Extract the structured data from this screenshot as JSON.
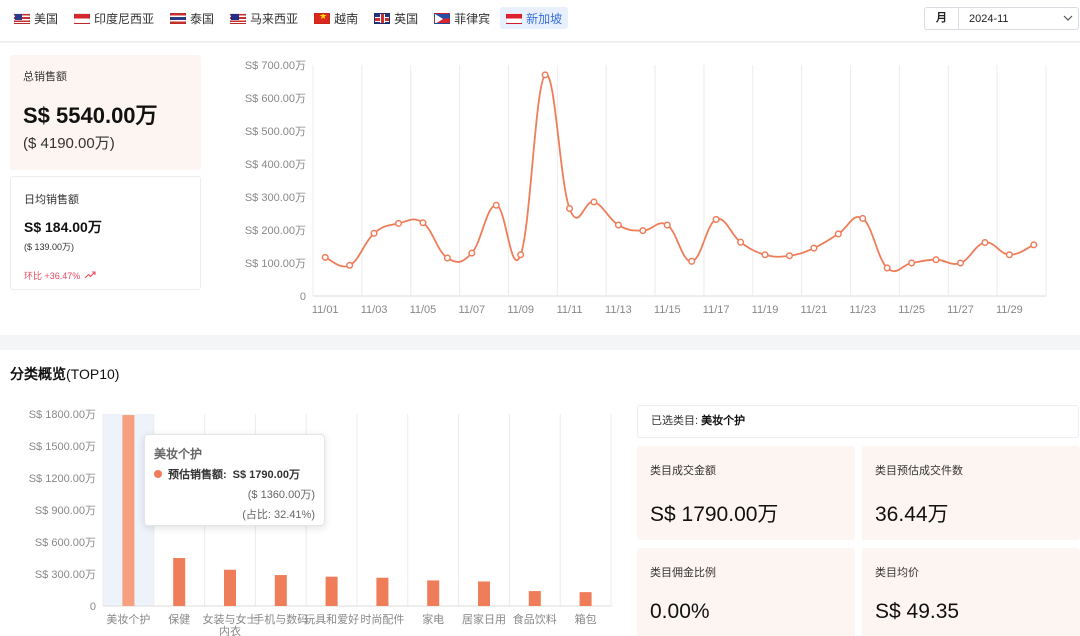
{
  "countries": [
    {
      "label": "美国",
      "flag": "us"
    },
    {
      "label": "印度尼西亚",
      "flag": "id"
    },
    {
      "label": "泰国",
      "flag": "th"
    },
    {
      "label": "马来西亚",
      "flag": "my"
    },
    {
      "label": "越南",
      "flag": "vn"
    },
    {
      "label": "英国",
      "flag": "uk"
    },
    {
      "label": "菲律宾",
      "flag": "ph"
    },
    {
      "label": "新加坡",
      "flag": "sg",
      "active": true
    }
  ],
  "month_picker": {
    "label": "月",
    "value": "2024-11"
  },
  "summary": {
    "total_label": "总销售额",
    "total_value": "S$ 5540.00万",
    "total_sub": "($ 4190.00万)",
    "daily_label": "日均销售额",
    "daily_value": "S$ 184.00万",
    "daily_sub": "($ 139.00万)",
    "mom": "环比 +36.47%"
  },
  "category_section": {
    "title": "分类概览",
    "title_suffix": "(TOP10)"
  },
  "tooltip": {
    "title": "美妆个护",
    "series": "预估销售额:",
    "value": "S$ 1790.00万",
    "usd": "($ 1360.00万)",
    "share": "(占比: 32.41%)"
  },
  "selected": {
    "label": "已选类目:",
    "value": "美妆个护"
  },
  "cards": [
    {
      "label": "类目成交金额",
      "value": "S$ 1790.00万"
    },
    {
      "label": "类目预估成交件数",
      "value": "36.44万"
    },
    {
      "label": "类目佣金比例",
      "value": "0.00%"
    },
    {
      "label": "类目均价",
      "value": "S$ 49.35"
    }
  ],
  "colors": {
    "accent": "#ef7d5a",
    "bar_highlight": "#f6a07f",
    "grid": "#e8e8e8"
  },
  "chart_data": [
    {
      "type": "line",
      "x": [
        "11/01",
        "11/02",
        "11/03",
        "11/04",
        "11/05",
        "11/06",
        "11/07",
        "11/08",
        "11/09",
        "11/10",
        "11/11",
        "11/12",
        "11/13",
        "11/14",
        "11/15",
        "11/16",
        "11/17",
        "11/18",
        "11/19",
        "11/20",
        "11/21",
        "11/22",
        "11/23",
        "11/24",
        "11/25",
        "11/26",
        "11/27",
        "11/28",
        "11/29",
        "11/30"
      ],
      "xtick_labels": [
        "11/01",
        "11/03",
        "11/05",
        "11/07",
        "11/09",
        "11/11",
        "11/13",
        "11/15",
        "11/17",
        "11/19",
        "11/21",
        "11/23",
        "11/25",
        "11/27",
        "11/29"
      ],
      "values": [
        117,
        93,
        190,
        220,
        222,
        115,
        130,
        275,
        125,
        670,
        265,
        285,
        215,
        198,
        215,
        105,
        232,
        163,
        125,
        122,
        145,
        188,
        235,
        85,
        100,
        110,
        100,
        162,
        125,
        155
      ],
      "ylim": [
        0,
        700
      ],
      "ytick_labels": [
        "0",
        "S$ 100.00万",
        "S$ 200.00万",
        "S$ 300.00万",
        "S$ 400.00万",
        "S$ 500.00万",
        "S$ 600.00万",
        "S$ 700.00万"
      ],
      "grid": true
    },
    {
      "type": "bar",
      "categories": [
        "美妆个护",
        "保健",
        "女装与女士内衣",
        "手机与数码",
        "玩具和爱好",
        "时尚配件",
        "家电",
        "居家日用",
        "食品饮料",
        "箱包"
      ],
      "values": [
        1790,
        450,
        340,
        290,
        275,
        265,
        240,
        230,
        140,
        130
      ],
      "ylim": [
        0,
        1800
      ],
      "ytick_labels": [
        "0",
        "S$ 300.00万",
        "S$ 600.00万",
        "S$ 900.00万",
        "S$ 1200.00万",
        "S$ 1500.00万",
        "S$ 1800.00万"
      ],
      "highlighted": "美妆个护",
      "grid": true
    }
  ]
}
